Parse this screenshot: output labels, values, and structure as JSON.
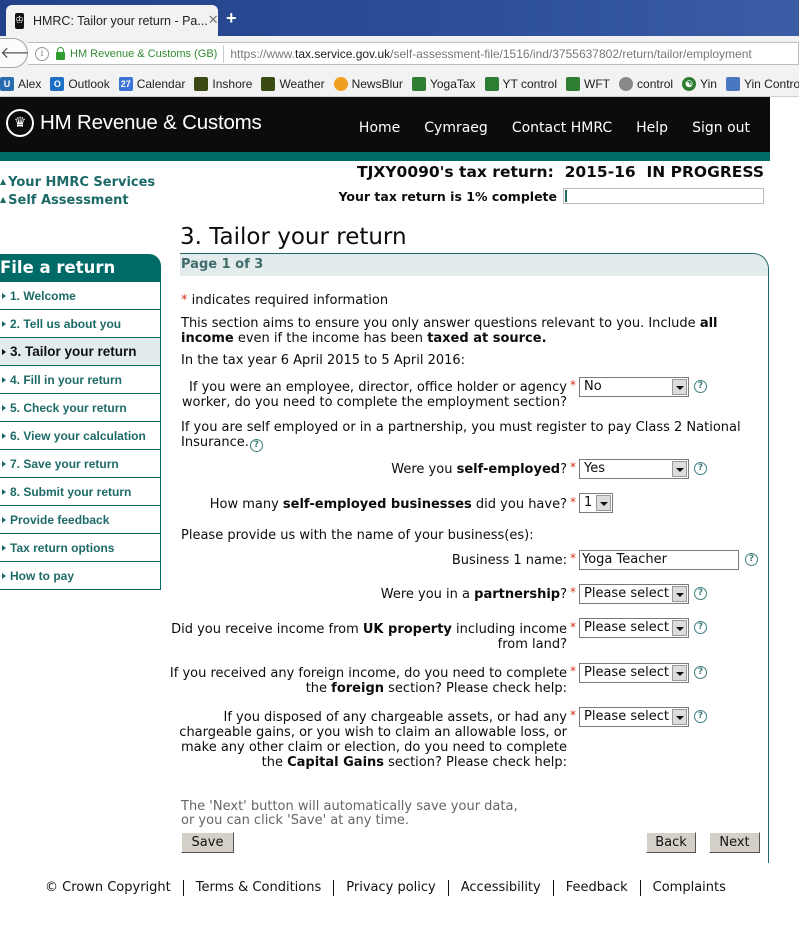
{
  "browser": {
    "tab_title": "HMRC: Tailor your return - Pa...",
    "site_identity": "HM Revenue & Customs (GB)",
    "url_prefix": "https://www.",
    "url_domain": "tax.service.gov.uk",
    "url_path": "/self-assessment-file/1516/ind/3755637802/return/tailor/employment",
    "bookmarks": [
      {
        "label": "Alex",
        "icon": "alex-icon",
        "color": "#2b6cb0",
        "glyph": "U"
      },
      {
        "label": "Outlook",
        "icon": "outlook-icon",
        "color": "#1e6fc7",
        "glyph": "O"
      },
      {
        "label": "Calendar",
        "icon": "calendar-icon",
        "color": "#3b74d6",
        "glyph": "27"
      },
      {
        "label": "Inshore",
        "icon": "met-office-icon",
        "color": "#3a4a12",
        "glyph": ""
      },
      {
        "label": "Weather",
        "icon": "met-office-icon",
        "color": "#3a4a12",
        "glyph": ""
      },
      {
        "label": "NewsBlur",
        "icon": "newsblur-icon",
        "color": "#f0a020",
        "glyph": ""
      },
      {
        "label": "YogaTax",
        "icon": "tree-icon",
        "color": "#2e7d32",
        "glyph": ""
      },
      {
        "label": "YT control",
        "icon": "tree-icon",
        "color": "#2e7d32",
        "glyph": ""
      },
      {
        "label": "WFT",
        "icon": "tree-icon",
        "color": "#2e7d32",
        "glyph": ""
      },
      {
        "label": "control",
        "icon": "globe-icon",
        "color": "#888888",
        "glyph": ""
      },
      {
        "label": "Yin",
        "icon": "yin-yang-icon",
        "color": "#2e7d32",
        "glyph": "☯"
      },
      {
        "label": "Yin Control",
        "icon": "yin-control-icon",
        "color": "#4a78c0",
        "glyph": ""
      },
      {
        "label": "",
        "icon": "twitter-icon",
        "color": "#1da1f2",
        "glyph": ""
      }
    ]
  },
  "header": {
    "logo_text": "HM Revenue & Customs",
    "nav": [
      "Home",
      "Cymraeg",
      "Contact HMRC",
      "Help",
      "Sign out"
    ]
  },
  "breadcrumbs": [
    "Your HMRC Services",
    "Self Assessment"
  ],
  "status": {
    "return_title": "TJXY0090's tax return:  2015-16  IN PROGRESS",
    "progress_label": "Your tax return is 1% complete",
    "progress_percent": 1
  },
  "sidebar": {
    "title": "File a return",
    "items": [
      {
        "label": "1. Welcome",
        "active": false
      },
      {
        "label": "2. Tell us about you",
        "active": false
      },
      {
        "label": "3. Tailor your return",
        "active": true
      },
      {
        "label": "4. Fill in your return",
        "active": false
      },
      {
        "label": "5. Check your return",
        "active": false
      },
      {
        "label": "6. View your calculation",
        "active": false
      },
      {
        "label": "7. Save your return",
        "active": false
      },
      {
        "label": "8. Submit your return",
        "active": false
      },
      {
        "label": "Provide feedback",
        "active": false
      },
      {
        "label": "Tax return options",
        "active": false
      },
      {
        "label": "How to pay",
        "active": false
      }
    ]
  },
  "main": {
    "title": "3. Tailor your return",
    "page_indicator": "Page 1 of 3",
    "required_note_star": "*",
    "required_note": " indicates required information",
    "intro_1": "This section aims to ensure you only answer questions relevant to you. Include ",
    "intro_bold_1": "all income",
    "intro_2": " even if the income has been ",
    "intro_bold_2": "taxed at source.",
    "tax_year_text": "In the tax year 6 April 2015 to 5 April 2016:",
    "class2_text": "If you are self employed or in a partnership, you must register to pay Class 2 National Insurance.",
    "business_names_text": "Please provide us with the name of your business(es):",
    "questions": {
      "employment": {
        "line1": "If you were an employee, director, office holder or agency",
        "line2": "worker, do you need to complete the employment section?",
        "value": "No"
      },
      "self_employed": {
        "pre": "Were you ",
        "bold": "self-employed",
        "post": "?",
        "value": "Yes"
      },
      "businesses": {
        "pre": "How many ",
        "bold": "self-employed businesses",
        "post": " did you have?",
        "value": "1"
      },
      "business_name": {
        "label": "Business 1 name:",
        "value": "Yoga Teacher"
      },
      "partnership": {
        "pre": "Were you in a ",
        "bold": "partnership",
        "post": "?",
        "value": "Please select"
      },
      "uk_property": {
        "pre": "Did you receive income from ",
        "bold": "UK property",
        "post": " including income",
        "line2": "from land?",
        "value": "Please select"
      },
      "foreign": {
        "line1": "If you received any foreign income, do you need to complete",
        "pre2": "the ",
        "bold": "foreign",
        "post2": " section? Please check help:",
        "value": "Please select"
      },
      "capital_gains": {
        "line1": "If you disposed of any chargeable assets, or had any",
        "line2": "chargeable gains, or you wish to claim an allowable loss, or",
        "line3": "make any other claim or election, do you need to complete",
        "pre4": "the ",
        "bold": "Capital Gains",
        "post4": " section? Please check help:",
        "value": "Please select"
      }
    },
    "save_note_1": "The 'Next' button will automatically save your data,",
    "save_note_2": "or you can click 'Save' at any time.",
    "buttons": {
      "save": "Save",
      "back": "Back",
      "next": "Next"
    },
    "required_star": "*",
    "help_glyph": "?"
  },
  "footer": [
    "© Crown Copyright",
    "Terms & Conditions",
    "Privacy policy",
    "Accessibility",
    "Feedback",
    "Complaints"
  ]
}
